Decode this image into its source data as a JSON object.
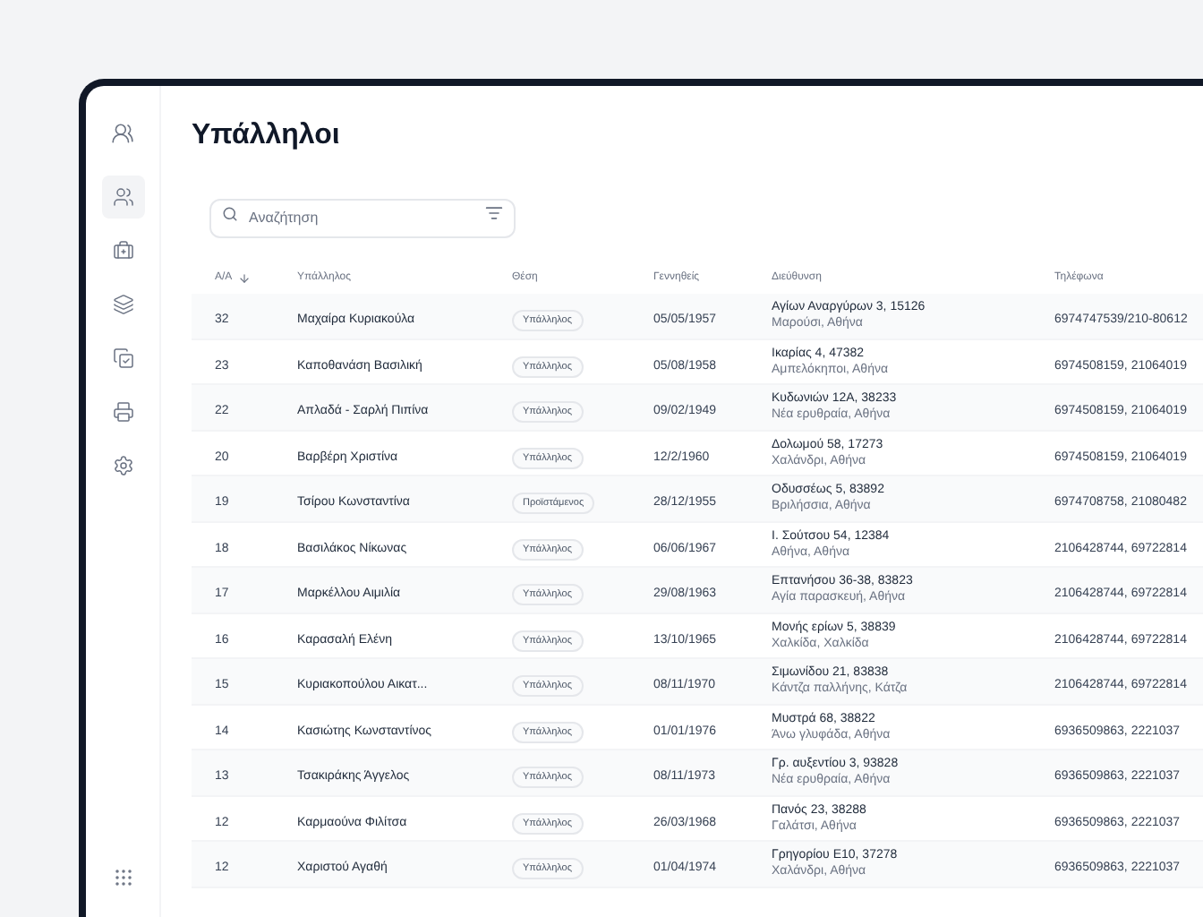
{
  "sidebar": {
    "items": [
      {
        "kind": "users",
        "selected": true
      },
      {
        "kind": "briefcase",
        "selected": false
      },
      {
        "kind": "layers",
        "selected": false
      },
      {
        "kind": "copy-check",
        "selected": false
      },
      {
        "kind": "printer",
        "selected": false
      },
      {
        "kind": "settings",
        "selected": false
      }
    ]
  },
  "title": "Υπάλληλοι",
  "search": {
    "placeholder": "Αναζήτηση"
  },
  "table": {
    "columns": [
      {
        "label": "Α/Α",
        "sorted": true
      },
      {
        "label": "Υπάλληλος",
        "sorted": false
      },
      {
        "label": "Θέση",
        "sorted": false
      },
      {
        "label": "Γεννηθείς",
        "sorted": false
      },
      {
        "label": "Διεύθυνση",
        "sorted": false
      },
      {
        "label": "Τηλέφωνα",
        "sorted": false
      }
    ],
    "rows": [
      {
        "id": "32",
        "name": "Μαχαίρα Κυριακούλα",
        "position": "Υπάλληλος",
        "birth": "05/05/1957",
        "street": "Αγίων Αναργύρων 3, 15126",
        "area": "Μαρούσι, Αθήνα",
        "phone": "6974747539/210-80612"
      },
      {
        "id": "23",
        "name": "Καποθανάση Βασιλική",
        "position": "Υπάλληλος",
        "birth": "05/08/1958",
        "street": "Ικαρίας 4, 47382",
        "area": "Αμπελόκηποι, Αθήνα",
        "phone": "6974508159, 21064019"
      },
      {
        "id": "22",
        "name": "Απλαδά - Σαρλή Πιπίνα",
        "position": "Υπάλληλος",
        "birth": "09/02/1949",
        "street": "Κυδωνιών 12Α, 38233",
        "area": "Νέα ερυθραία, Αθήνα",
        "phone": "6974508159, 21064019"
      },
      {
        "id": "20",
        "name": "Βαρβέρη Χριστίνα",
        "position": "Υπάλληλος",
        "birth": "12/2/1960",
        "street": "Δολωμού 58, 17273",
        "area": "Χαλάνδρι, Αθήνα",
        "phone": "6974508159, 21064019"
      },
      {
        "id": "19",
        "name": "Τσίρου Κωνσταντίνα",
        "position": "Προϊστάμενος",
        "birth": "28/12/1955",
        "street": "Οδυσσέως 5, 83892",
        "area": "Βριλήσσια, Αθήνα",
        "phone": "6974708758, 21080482"
      },
      {
        "id": "18",
        "name": "Βασιλάκος Νίκωνας",
        "position": "Υπάλληλος",
        "birth": "06/06/1967",
        "street": "Ι. Σούτσου 54, 12384",
        "area": "Αθήνα, Αθήνα",
        "phone": "2106428744, 69722814"
      },
      {
        "id": "17",
        "name": "Μαρκέλλου Αιμιλία",
        "position": "Υπάλληλος",
        "birth": "29/08/1963",
        "street": "Επτανήσου 36-38, 83823",
        "area": "Αγία παρασκευή, Αθήνα",
        "phone": "2106428744, 69722814"
      },
      {
        "id": "16",
        "name": "Καρασαλή Ελένη",
        "position": "Υπάλληλος",
        "birth": "13/10/1965",
        "street": "Μονής ερίων 5, 38839",
        "area": "Χαλκίδα, Χαλκίδα",
        "phone": "2106428744, 69722814"
      },
      {
        "id": "15",
        "name": "Κυριακοπούλου Αικατ...",
        "position": "Υπάλληλος",
        "birth": "08/11/1970",
        "street": "Σιμωνίδου 21, 83838",
        "area": "Κάντζα παλλήνης, Κάτζα",
        "phone": "2106428744, 69722814"
      },
      {
        "id": "14",
        "name": "Κασιώτης Κωνσταντίνος",
        "position": "Υπάλληλος",
        "birth": "01/01/1976",
        "street": "Μυστρά 68, 38822",
        "area": "Άνω γλυφάδα, Αθήνα",
        "phone": "6936509863, 2221037"
      },
      {
        "id": "13",
        "name": "Τσακιράκης Άγγελος",
        "position": "Υπάλληλος",
        "birth": "08/11/1973",
        "street": "Γρ. αυξεντίου 3, 93828",
        "area": "Νέα ερυθραία, Αθήνα",
        "phone": "6936509863, 2221037"
      },
      {
        "id": "12",
        "name": "Καρμαούνα Φιλίτσα",
        "position": "Υπάλληλος",
        "birth": "26/03/1968",
        "street": "Πανός 23, 38288",
        "area": "Γαλάτσι, Αθήνα",
        "phone": "6936509863, 2221037"
      },
      {
        "id": "12",
        "name": "Χαριστού Αγαθή",
        "position": "Υπάλληλος",
        "birth": "01/04/1974",
        "street": "Γρηγορίου Ε10, 37278",
        "area": "Χαλάνδρι, Αθήνα",
        "phone": "6936509863, 2221037"
      }
    ]
  }
}
